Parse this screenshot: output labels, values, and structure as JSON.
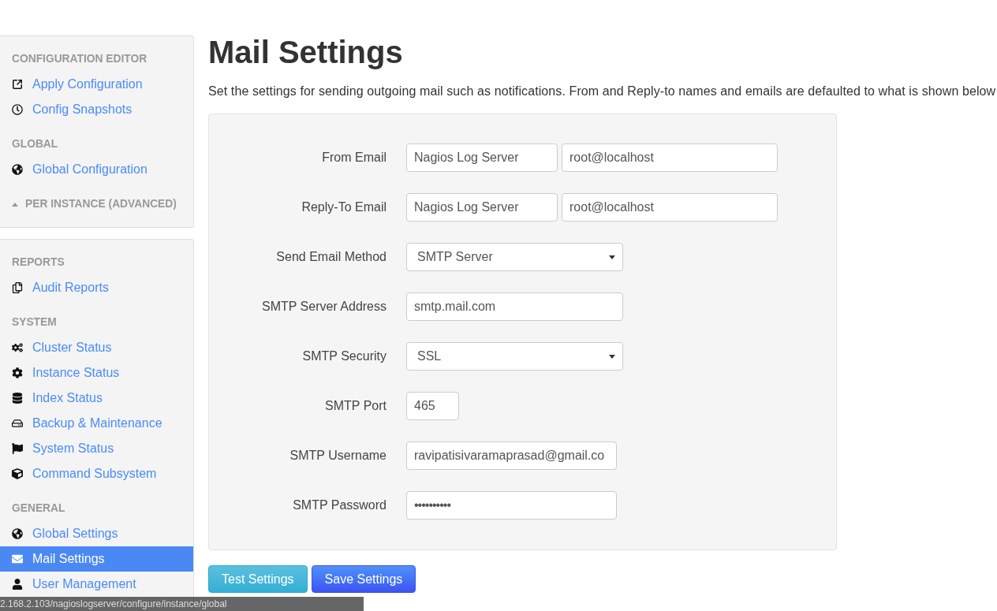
{
  "sidebar": {
    "panels": [
      {
        "sections": [
          {
            "kind": "group",
            "heading": "CONFIGURATION EDITOR",
            "items": [
              {
                "label": "Apply Configuration",
                "selected": false
              },
              {
                "label": "Config Snapshots",
                "selected": false
              }
            ]
          },
          {
            "kind": "group",
            "heading": "GLOBAL",
            "items": [
              {
                "label": "Global Configuration",
                "selected": false
              }
            ]
          },
          {
            "kind": "collapsible",
            "heading": "PER INSTANCE (ADVANCED)",
            "expanded": false
          }
        ]
      },
      {
        "sections": [
          {
            "kind": "group",
            "heading": "REPORTS",
            "items": [
              {
                "label": "Audit Reports",
                "selected": false
              }
            ]
          },
          {
            "kind": "group",
            "heading": "SYSTEM",
            "items": [
              {
                "label": "Cluster Status",
                "selected": false
              },
              {
                "label": "Instance Status",
                "selected": false
              },
              {
                "label": "Index Status",
                "selected": false
              },
              {
                "label": "Backup & Maintenance",
                "selected": false
              },
              {
                "label": "System Status",
                "selected": false
              },
              {
                "label": "Command Subsystem",
                "selected": false
              }
            ]
          },
          {
            "kind": "group",
            "heading": "GENERAL",
            "items": [
              {
                "label": "Global Settings",
                "selected": false
              },
              {
                "label": "Mail Settings",
                "selected": true
              },
              {
                "label": "User Management",
                "selected": false
              }
            ]
          }
        ]
      }
    ]
  },
  "page": {
    "title": "Mail Settings",
    "description": "Set the settings for sending outgoing mail such as notifications. From and Reply-to names and emails are defaulted to what is shown below"
  },
  "form": {
    "rows": [
      {
        "label": "From Email",
        "fields": [
          {
            "kind": "text",
            "value": "Nagios Log Server"
          },
          {
            "kind": "text",
            "value": "root@localhost"
          }
        ]
      },
      {
        "label": "Reply-To Email",
        "fields": [
          {
            "kind": "text",
            "value": "Nagios Log Server"
          },
          {
            "kind": "text",
            "value": "root@localhost"
          }
        ]
      },
      {
        "label": "Send Email Method",
        "fields": [
          {
            "kind": "select",
            "value": "SMTP Server"
          }
        ]
      },
      {
        "label": "SMTP Server Address",
        "fields": [
          {
            "kind": "text",
            "value": "smtp.mail.com"
          }
        ]
      },
      {
        "label": "SMTP Security",
        "fields": [
          {
            "kind": "select",
            "value": "SSL"
          }
        ]
      },
      {
        "label": "SMTP Port",
        "fields": [
          {
            "kind": "text",
            "value": "465"
          }
        ]
      },
      {
        "label": "SMTP Username",
        "fields": [
          {
            "kind": "text",
            "value": "ravipatisivaramaprasad@gmail.co"
          }
        ]
      },
      {
        "label": "SMTP Password",
        "fields": [
          {
            "kind": "password",
            "value": "••••••••••"
          }
        ]
      }
    ]
  },
  "buttons": [
    {
      "label": "Test Settings",
      "kind": "info"
    },
    {
      "label": "Save Settings",
      "kind": "primary"
    }
  ],
  "status_bar": {
    "url": "2.168.2.103/nagioslogserver/configure/instance/global"
  }
}
